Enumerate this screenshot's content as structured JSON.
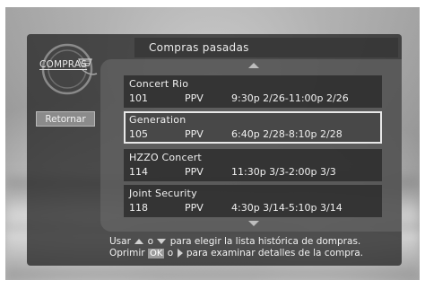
{
  "header": {
    "title": "Compras pasadas"
  },
  "logo": {
    "label": "COMPRAS",
    "icon": "shopping-basket-icon"
  },
  "sidebar": {
    "back_label": "Retornar"
  },
  "list": {
    "scroll_up_icon": "arrow-up-icon",
    "scroll_down_icon": "arrow-down-icon",
    "selected_index": 1,
    "items": [
      {
        "title": "Concert Rio",
        "channel": "101",
        "type": "PPV",
        "time": "9:30p 2/26-11:00p 2/26"
      },
      {
        "title": "Generation",
        "channel": "105",
        "type": "PPV",
        "time": "6:40p 2/28-8:10p 2/28"
      },
      {
        "title": "HZZO Concert",
        "channel": "114",
        "type": "PPV",
        "time": "11:30p 3/3-2:00p 3/3"
      },
      {
        "title": "Joint Security",
        "channel": "118",
        "type": "PPV",
        "time": "4:30p 3/14-5:10p 3/14"
      }
    ]
  },
  "help": {
    "line1_a": "Usar",
    "line1_o": "o",
    "line1_b": "para elegir la lista histórica de dompras.",
    "line2_a": "Oprimir",
    "line2_ok": "OK",
    "line2_o": "o",
    "line2_b": "para examinar detalles de la compra."
  },
  "colors": {
    "panel": "#2b2b2b",
    "selected_border": "#e8e8e8",
    "text": "#f0f0f0"
  }
}
